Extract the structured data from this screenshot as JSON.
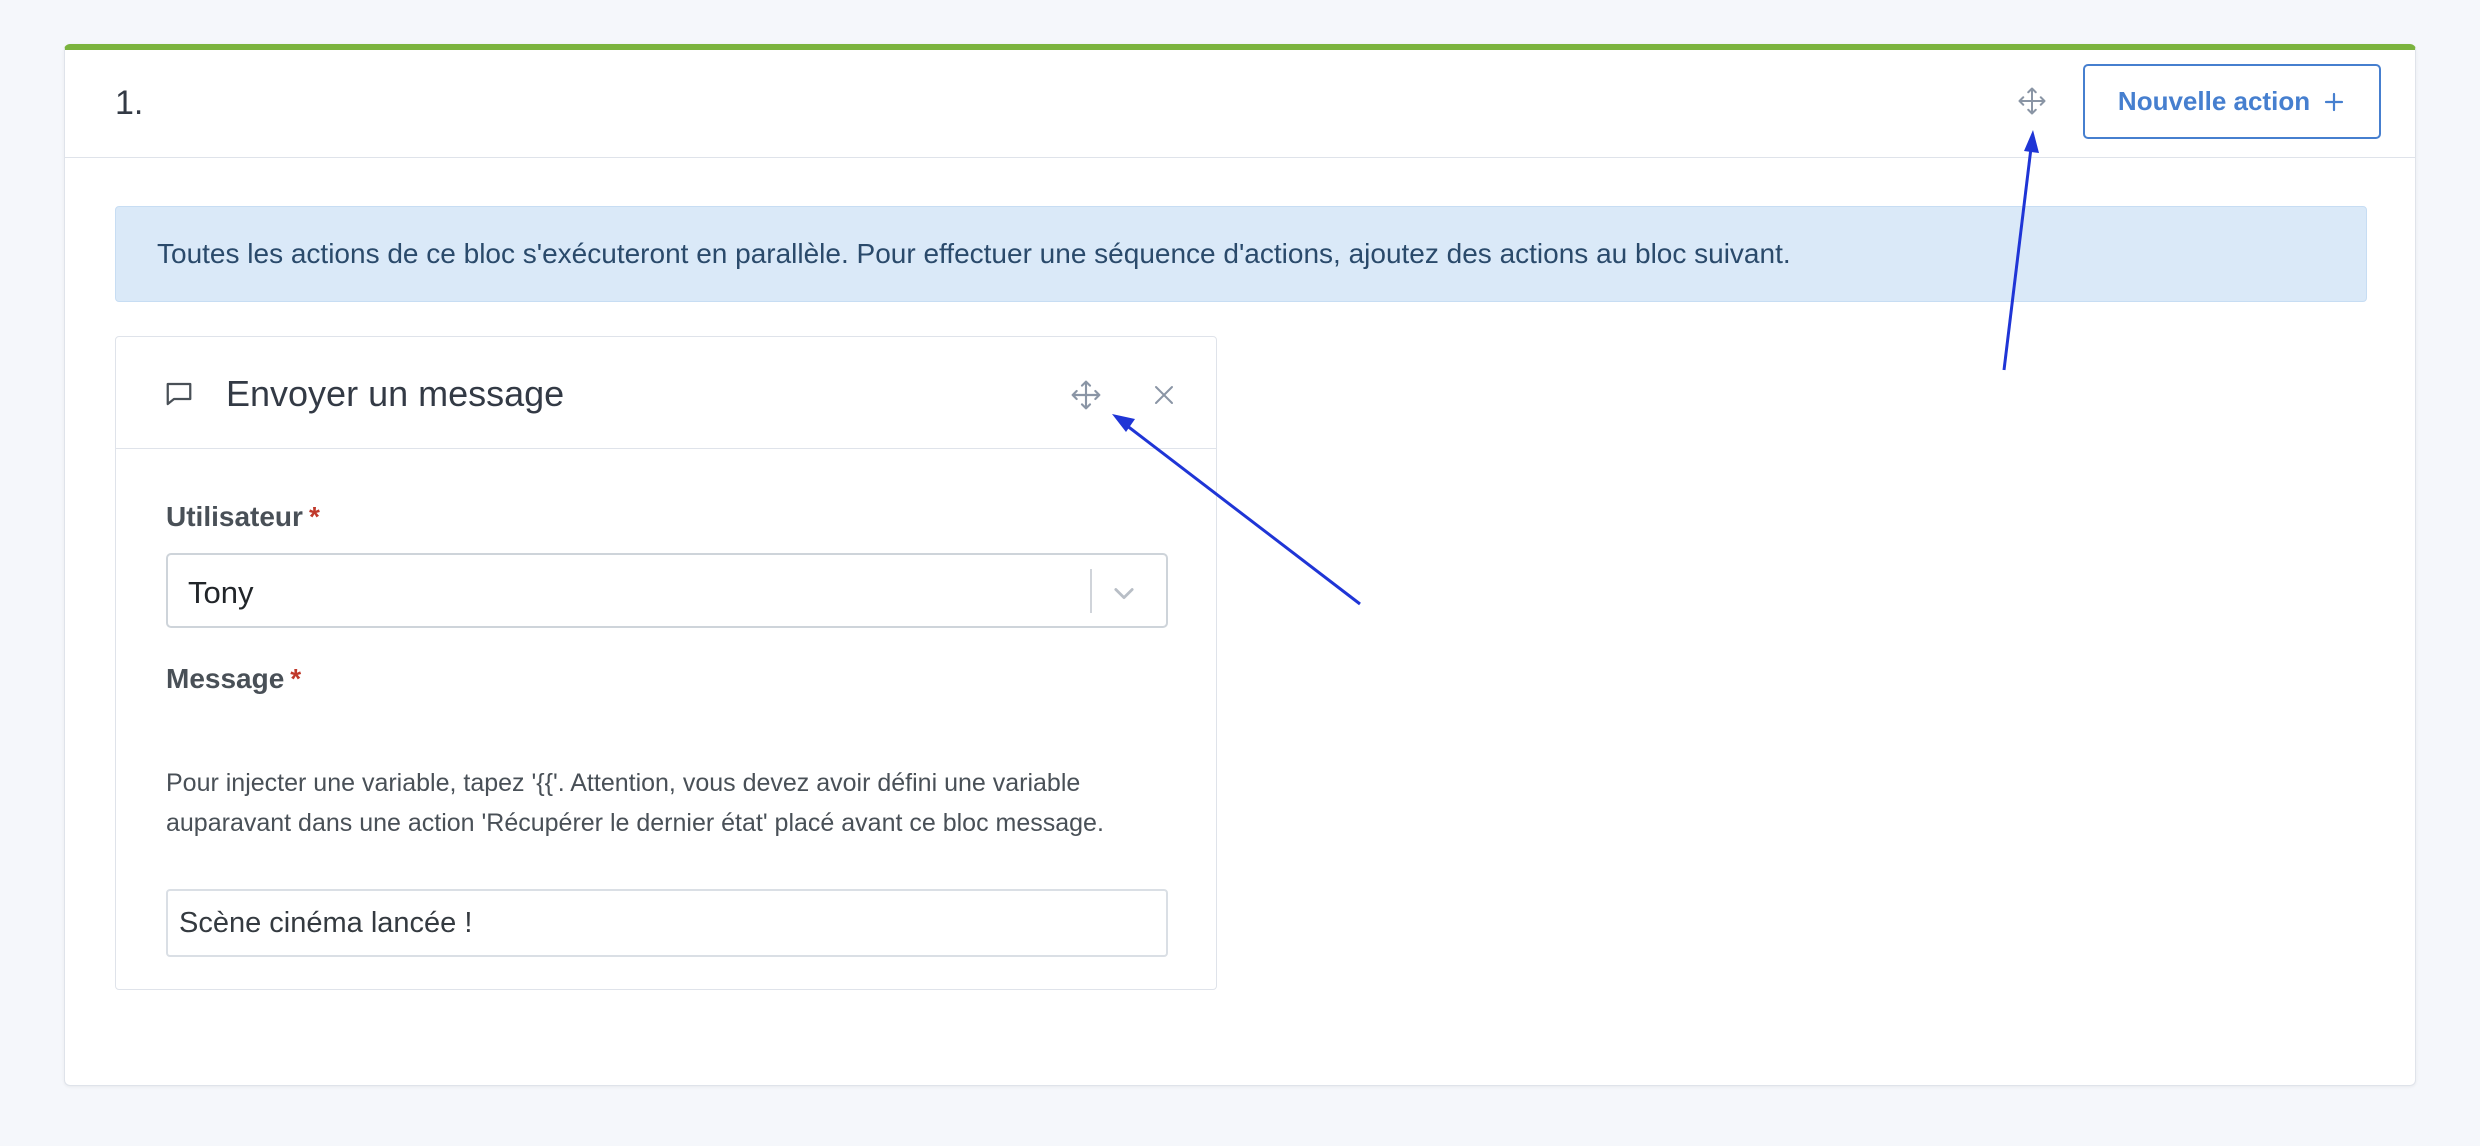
{
  "block": {
    "title": "1.",
    "new_action_label": "Nouvelle action",
    "info_text": "Toutes les actions de ce bloc s'exécuteront en parallèle. Pour effectuer une séquence d'actions, ajoutez des actions au bloc suivant."
  },
  "action": {
    "title": "Envoyer un message",
    "user_field": {
      "label": "Utilisateur",
      "required_mark": "*",
      "value": "Tony"
    },
    "message_field": {
      "label": "Message",
      "required_mark": "*",
      "help": "Pour injecter une variable, tapez '{{'. Attention, vous devez avoir défini une variable auparavant dans une action 'Récupérer le dernier état' placé avant ce bloc message.",
      "value": "Scène cinéma lancée !"
    }
  },
  "icons": {
    "header_move": "move-icon",
    "plus": "plus-icon",
    "message": "message-icon",
    "action_move": "move-icon",
    "close": "close-icon",
    "chevron": "chevron-down-icon"
  },
  "colors": {
    "accent": "#467fcf",
    "block_top_border": "#7bb33e",
    "info_background": "#dae9f8",
    "annotation_arrow": "#1f35d6",
    "required": "#c0392b"
  }
}
